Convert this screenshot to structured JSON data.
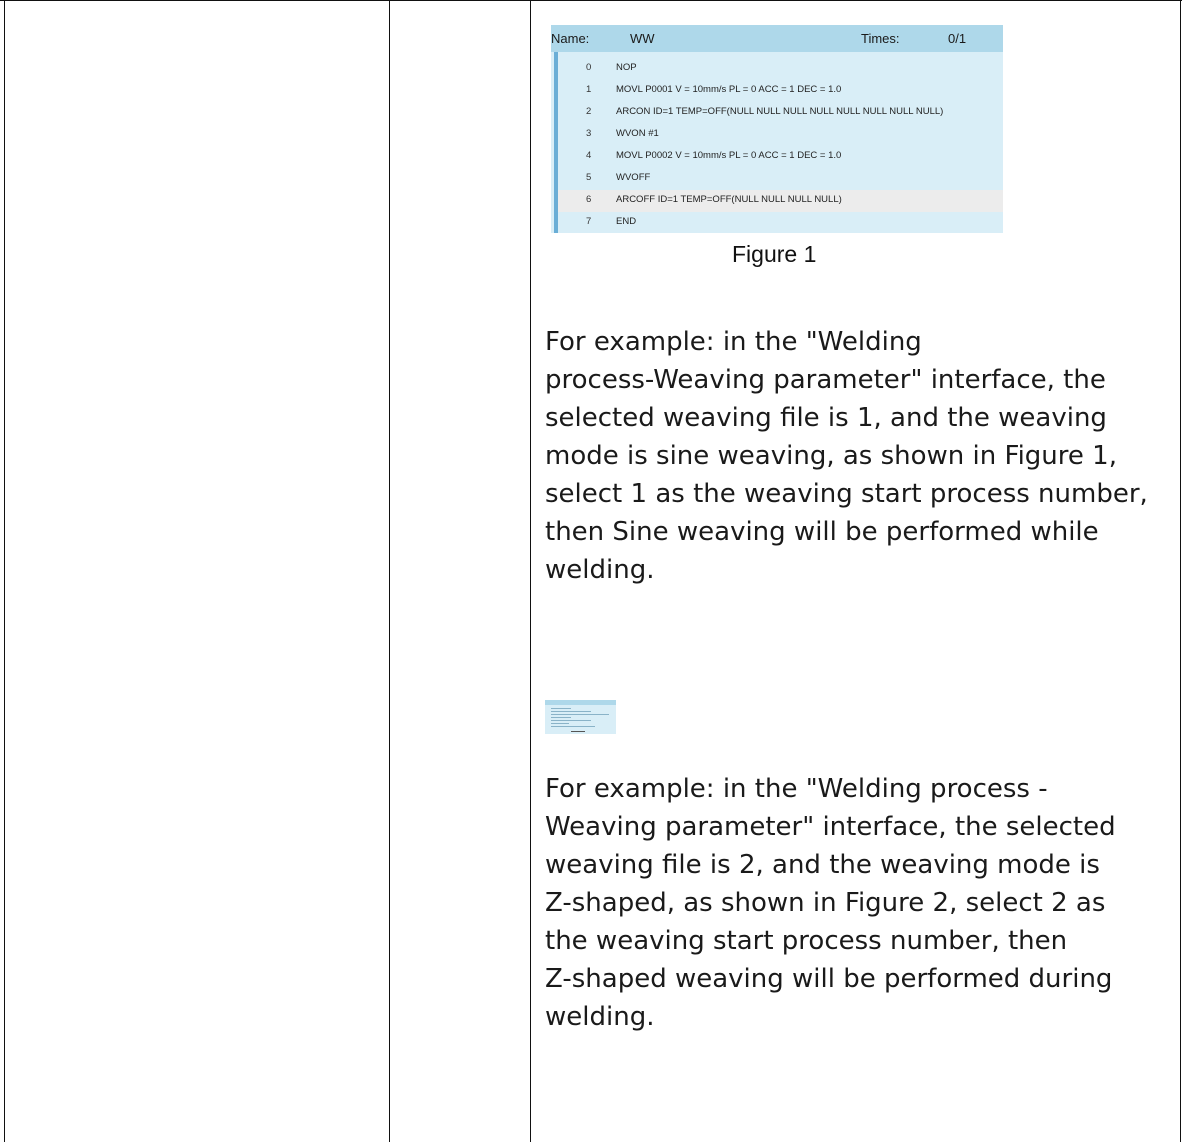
{
  "figure1": {
    "header": {
      "name_label": "Name:",
      "name_value": "WW",
      "times_label": "Times:",
      "times_value": "0/1"
    },
    "lines": [
      {
        "num": "0",
        "cmd": "NOP"
      },
      {
        "num": "1",
        "cmd": "MOVL P0001 V = 10mm/s PL = 0 ACC = 1 DEC = 1.0"
      },
      {
        "num": "2",
        "cmd": "ARCON ID=1 TEMP=OFF(NULL NULL NULL NULL NULL NULL NULL NULL)"
      },
      {
        "num": "3",
        "cmd": "WVON #1"
      },
      {
        "num": "4",
        "cmd": "MOVL P0002 V = 10mm/s PL = 0 ACC = 1 DEC = 1.0"
      },
      {
        "num": "5",
        "cmd": "WVOFF"
      },
      {
        "num": "6",
        "cmd": "ARCOFF ID=1 TEMP=OFF(NULL NULL NULL NULL)"
      },
      {
        "num": "7",
        "cmd": "END"
      }
    ],
    "caption": "Figure 1"
  },
  "paragraph1": {
    "lines": [
      "For example: in the \"Welding",
      "process-Weaving parameter\" interface, the",
      "selected weaving file is 1, and the weaving",
      "mode is sine weaving, as shown in Figure 1,",
      "select 1 as the weaving start process number,",
      "then Sine weaving will be performed while",
      "welding."
    ]
  },
  "paragraph2": {
    "lines": [
      "For example: in the \"Welding process -",
      "Weaving parameter\" interface, the selected",
      "weaving file is 2, and the weaving mode is",
      "Z-shaped, as shown in Figure 2, select 2 as",
      "the weaving start process number, then",
      "Z-shaped weaving will be performed during",
      "welding."
    ]
  }
}
